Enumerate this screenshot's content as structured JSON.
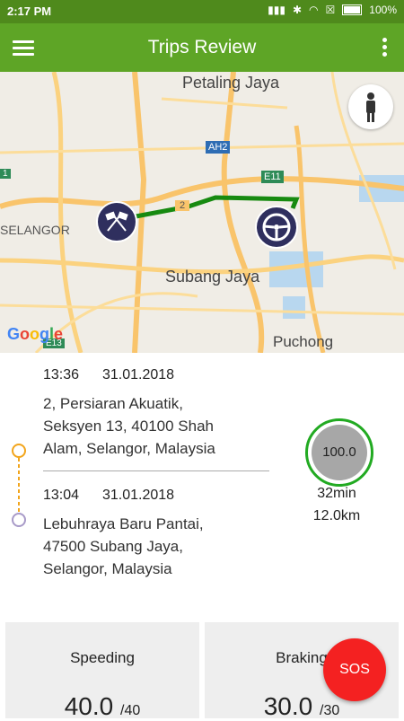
{
  "status_bar": {
    "time": "2:17 PM",
    "battery": "100%"
  },
  "app_bar": {
    "title": "Trips Review"
  },
  "map": {
    "labels": {
      "petaling_jaya": "Petaling Jaya",
      "subang_jaya": "Subang Jaya",
      "puchong": "Puchong",
      "selangor": "SELANGOR",
      "ah2": "AH2",
      "e11": "E11",
      "route2": "2",
      "e13": "E13",
      "route1": "1"
    },
    "attribution": {
      "g1": "G",
      "o1": "o",
      "o2": "o",
      "g2": "g",
      "l": "l",
      "e": "e"
    }
  },
  "trip": {
    "end": {
      "time": "13:36",
      "date": "31.01.2018",
      "address_lines": [
        "2, Persiaran Akuatik,",
        "Seksyen 13, 40100 Shah",
        "Alam, Selangor, Malaysia"
      ]
    },
    "start": {
      "time": "13:04",
      "date": "31.01.2018",
      "address_lines": [
        "Lebuhraya Baru Pantai,",
        "47500 Subang Jaya,",
        "Selangor, Malaysia"
      ]
    },
    "score": "100.0",
    "duration": "32min",
    "distance": "12.0km"
  },
  "cards": {
    "speeding": {
      "label": "Speeding",
      "value": "40.0",
      "max": "/40"
    },
    "braking": {
      "label": "Braking",
      "value": "30.0",
      "max": "/30"
    }
  },
  "sos": {
    "label": "SOS"
  },
  "colors": {
    "primary": "#5ea526",
    "status_bar": "#4f8a1c",
    "route": "#178a10",
    "score_ring": "#22aa22",
    "sos": "#f42121"
  }
}
